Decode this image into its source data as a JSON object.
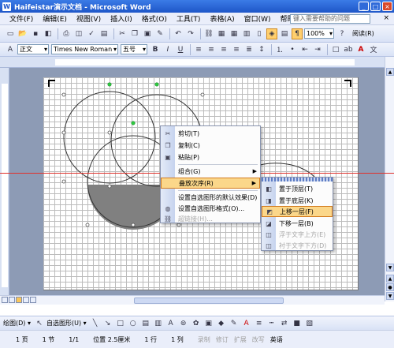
{
  "window": {
    "title": "Haifeistar演示文档 - Microsoft Word",
    "controls": [
      "_",
      "□",
      "×"
    ]
  },
  "menu": {
    "items": [
      "文件(F)",
      "编辑(E)",
      "视图(V)",
      "插入(I)",
      "格式(O)",
      "工具(T)",
      "表格(A)",
      "窗口(W)",
      "帮助(H)"
    ],
    "help_placeholder": "键入需要帮助的问题",
    "help_close": "×"
  },
  "toolbar": {
    "zoom": "100%",
    "read_label": "阅读(R)"
  },
  "format_toolbar": {
    "style": "正文",
    "font": "Times New Roman",
    "size": "五号",
    "bold": "B",
    "italic": "I",
    "underline": "U",
    "font_color": "A"
  },
  "context_menu": {
    "items": [
      {
        "label": "剪切(T)",
        "icon": "scissors-icon"
      },
      {
        "label": "复制(C)",
        "icon": "copy-icon"
      },
      {
        "label": "粘贴(P)",
        "icon": "paste-icon"
      },
      {
        "label": "组合(G)",
        "icon": "",
        "submenu": true
      },
      {
        "label": "叠放次序(R)",
        "icon": "",
        "submenu": true,
        "highlighted": true
      },
      {
        "label": "设置自选图形的默认效果(D)",
        "icon": ""
      },
      {
        "label": "设置自选图形格式(O)...",
        "icon": "format-shape-icon"
      },
      {
        "label": "超链接(H)...",
        "icon": "hyperlink-icon",
        "disabled": true
      }
    ]
  },
  "submenu": {
    "items": [
      {
        "label": "置于顶层(T)",
        "icon": "bring-to-front-icon"
      },
      {
        "label": "置于底层(K)",
        "icon": "send-to-back-icon"
      },
      {
        "label": "上移一层(F)",
        "icon": "bring-forward-icon",
        "highlighted": true
      },
      {
        "label": "下移一层(B)",
        "icon": "send-backward-icon"
      },
      {
        "label": "浮于文字上方(E)",
        "icon": "float-above-icon",
        "disabled": true
      },
      {
        "label": "衬于文字下方(D)",
        "icon": "behind-text-icon",
        "disabled": true
      }
    ]
  },
  "drawing_toolbar": {
    "draw_label": "绘图(D) ▾",
    "autoshapes_label": "自选图形(U) ▾"
  },
  "statusbar": {
    "page": "1 页",
    "section": "1 节",
    "page_of": "1/1",
    "position": "位置 2.5厘米",
    "line": "1 行",
    "column": "1 列",
    "modes": [
      "录制",
      "修订",
      "扩展",
      "改写"
    ],
    "language": "英语"
  },
  "colors": {
    "highlight": "#fbd78a",
    "annotation_red": "#e0312b",
    "shape_fill": "#808080"
  }
}
